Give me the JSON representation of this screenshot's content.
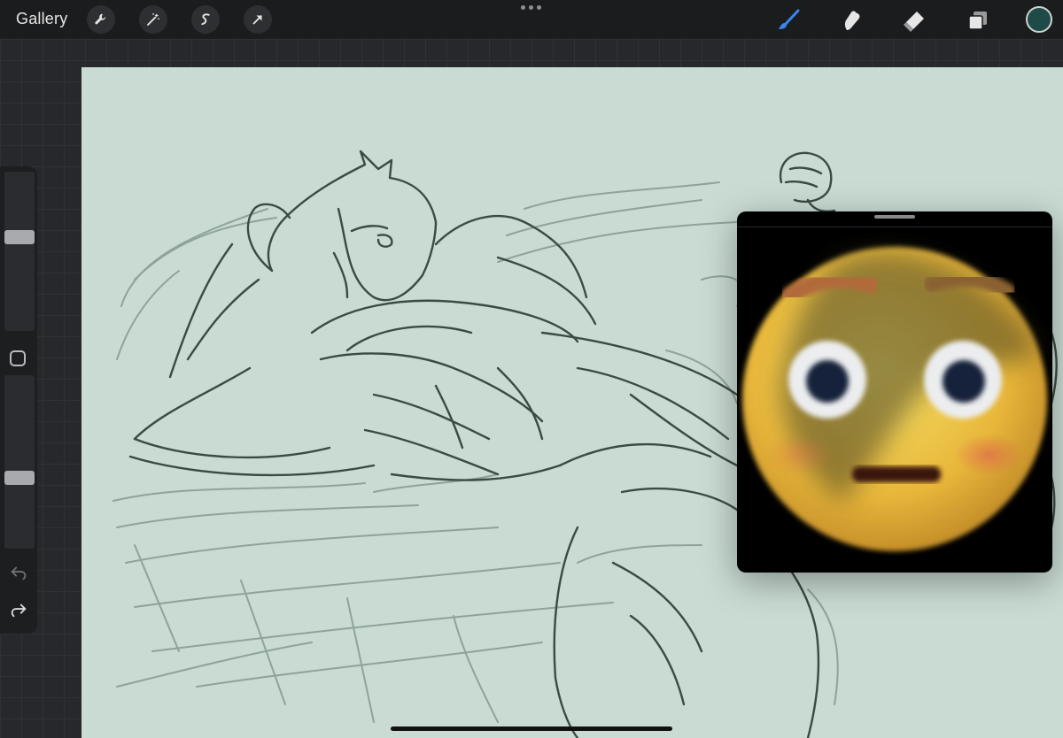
{
  "topbar": {
    "gallery_label": "Gallery",
    "tools_left": [
      "wrench-icon",
      "magic-wand-icon",
      "selection-icon",
      "transform-arrow-icon"
    ],
    "tools_right": [
      "brush-icon",
      "smudge-icon",
      "eraser-icon",
      "layers-icon"
    ],
    "active_tool": "brush-icon",
    "active_tool_color": "#3a86f0",
    "current_color": "#1e4a48"
  },
  "sidebar": {
    "brush_size_level": 0.6,
    "opacity_level": 0.4
  },
  "canvas": {
    "background_color": "#c9dbd3",
    "line_color": "#3c4a44"
  },
  "pip": {
    "content": "blushing-emoji"
  }
}
